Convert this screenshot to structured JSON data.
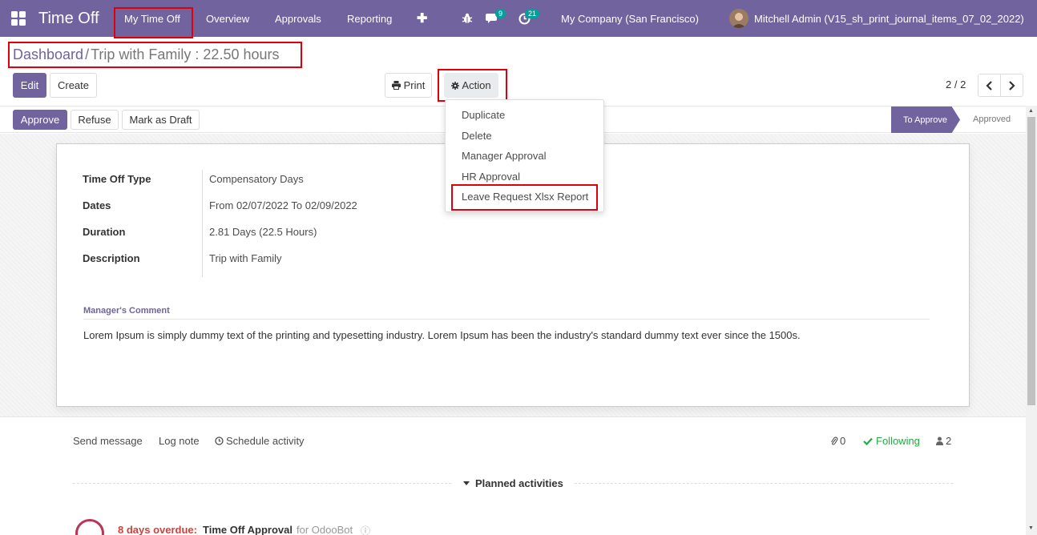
{
  "navbar": {
    "app_title": "Time Off",
    "menu": [
      "My Time Off",
      "Overview",
      "Approvals",
      "Reporting"
    ],
    "plus": "✚",
    "chat_badge": "9",
    "activity_badge": "21",
    "company": "My Company (San Francisco)",
    "user": "Mitchell Admin (V15_sh_print_journal_items_07_02_2022)"
  },
  "breadcrumb": {
    "parent": "Dashboard",
    "separator": "/",
    "current": "Trip with Family : 22.50 hours"
  },
  "control": {
    "edit": "Edit",
    "create": "Create",
    "print": "Print",
    "action": "Action",
    "pager": "2 / 2"
  },
  "action_menu": [
    "Duplicate",
    "Delete",
    "Manager Approval",
    "HR Approval",
    "Leave Request Xlsx Report"
  ],
  "status": {
    "approve": "Approve",
    "refuse": "Refuse",
    "draft": "Mark as Draft",
    "stage_active": "To Approve",
    "stage_next": "Approved"
  },
  "form": {
    "type_label": "Time Off Type",
    "type_value": "Compensatory Days",
    "dates_label": "Dates",
    "dates_value": "From 02/07/2022 To 02/09/2022",
    "duration_label": "Duration",
    "duration_value": "2.81 Days (22.5 Hours)",
    "description_label": "Description",
    "description_value": "Trip with Family",
    "comment_label": "Manager's Comment",
    "comment_text": "Lorem Ipsum is simply dummy text of the printing and typesetting industry. Lorem Ipsum has been the industry's standard dummy text ever since the 1500s."
  },
  "chatter": {
    "send_message": "Send message",
    "log_note": "Log note",
    "schedule_activity": "Schedule activity",
    "attachments": "0",
    "following": "Following",
    "followers": "2",
    "planned_title": "Planned activities",
    "overdue": "8 days overdue:",
    "activity_title": "Time Off Approval",
    "activity_for": "for OdooBot"
  },
  "colors": {
    "brand": "#71639e",
    "highlight": "#e0000b",
    "following": "#28a745",
    "overdue": "#d23f3a"
  }
}
